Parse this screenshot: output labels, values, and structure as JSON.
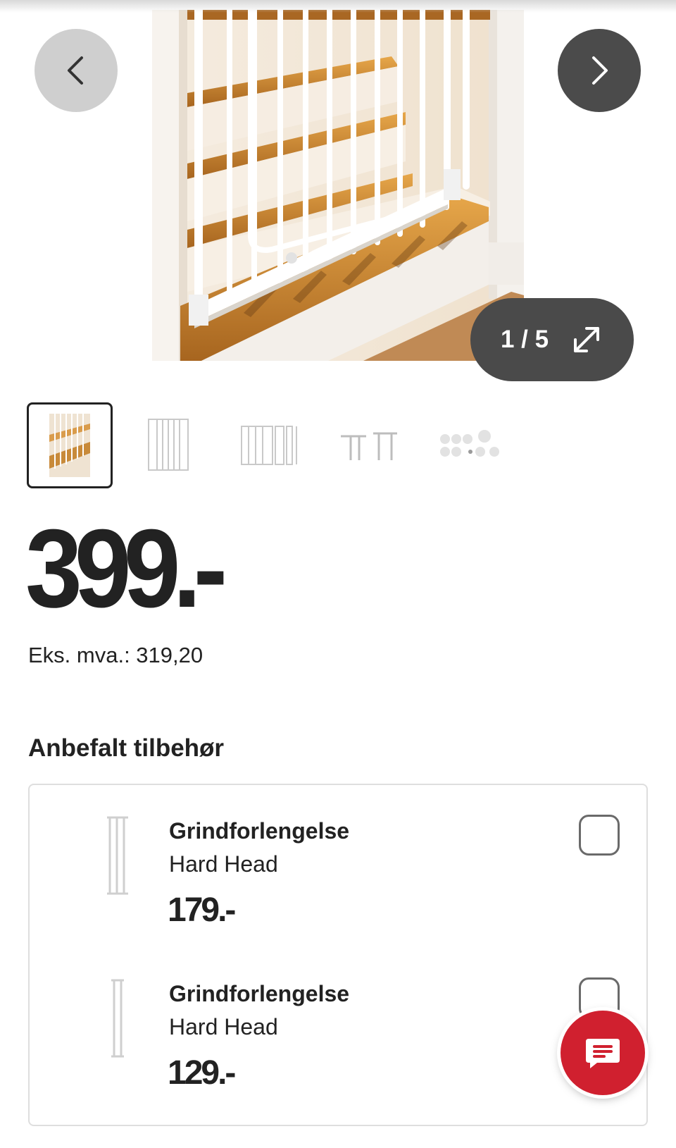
{
  "gallery": {
    "counter": "1 / 5",
    "prev_icon": "chevron-left-icon",
    "next_icon": "chevron-right-icon",
    "expand_icon": "expand-icon",
    "thumbnails": [
      "stair-gate-photo",
      "gate-front-view",
      "gate-with-extensions",
      "mounting-parts",
      "wall-cups"
    ]
  },
  "product": {
    "price": "399.-",
    "eks_mva": "Eks. mva.: 319,20"
  },
  "accessories": {
    "title": "Anbefalt tilbehør",
    "items": [
      {
        "name": "Grindforlengelse",
        "brand": "Hard Head",
        "price": "179.-",
        "checked": false
      },
      {
        "name": "Grindforlengelse",
        "brand": "Hard Head",
        "price": "129.-",
        "checked": false
      }
    ]
  },
  "chat": {
    "icon": "chat-bubble-icon"
  },
  "colors": {
    "chat_red": "#d0202f",
    "next_button": "#4b4b4b",
    "prev_button": "#cfcfcf",
    "text": "#222222"
  }
}
